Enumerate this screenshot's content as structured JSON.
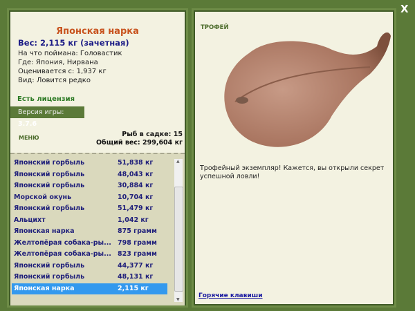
{
  "fish": {
    "name": "Японская нарка",
    "weight": "Вес: 2,115 кг (зачетная)",
    "bait": "На что поймана: Головастик",
    "place": "Где: Япония, Нирвана",
    "rated": "Оценивается с: 1,937 кг",
    "kind": "Вид: Ловится редко"
  },
  "license": "Есть лицензия",
  "version": {
    "label": "Версия игры:",
    "value": "3.7.6"
  },
  "menu": "МЕНЮ",
  "stats": {
    "count": "Рыб в садке: 15",
    "total": "Общий вес: 299,604 кг"
  },
  "catch_list": [
    {
      "name": "Японский горбыль",
      "weight": "51,838 кг"
    },
    {
      "name": "Японский горбыль",
      "weight": "48,043 кг"
    },
    {
      "name": "Японский горбыль",
      "weight": "30,884 кг"
    },
    {
      "name": "Морской окунь",
      "weight": "10,704 кг"
    },
    {
      "name": "Японский горбыль",
      "weight": "51,479 кг"
    },
    {
      "name": "Альцихт",
      "weight": "1,042 кг"
    },
    {
      "name": "Японская нарка",
      "weight": "875 грамм"
    },
    {
      "name": "Желтопёрая собака-ры...",
      "weight": "798 грамм"
    },
    {
      "name": "Желтопёрая собака-ры...",
      "weight": "823 грамм"
    },
    {
      "name": "Японский горбыль",
      "weight": "44,377 кг"
    },
    {
      "name": "Японский горбыль",
      "weight": "48,131 кг"
    },
    {
      "name": "Японская нарка",
      "weight": "2,115 кг"
    }
  ],
  "selected_index": 11,
  "trophy": {
    "label": "ТРОФЕЙ",
    "description": "Трофейный экземпляр! Кажется, вы открыли секрет успешной ловли!"
  },
  "hotkeys": "Горячие клавиши",
  "close": "X"
}
